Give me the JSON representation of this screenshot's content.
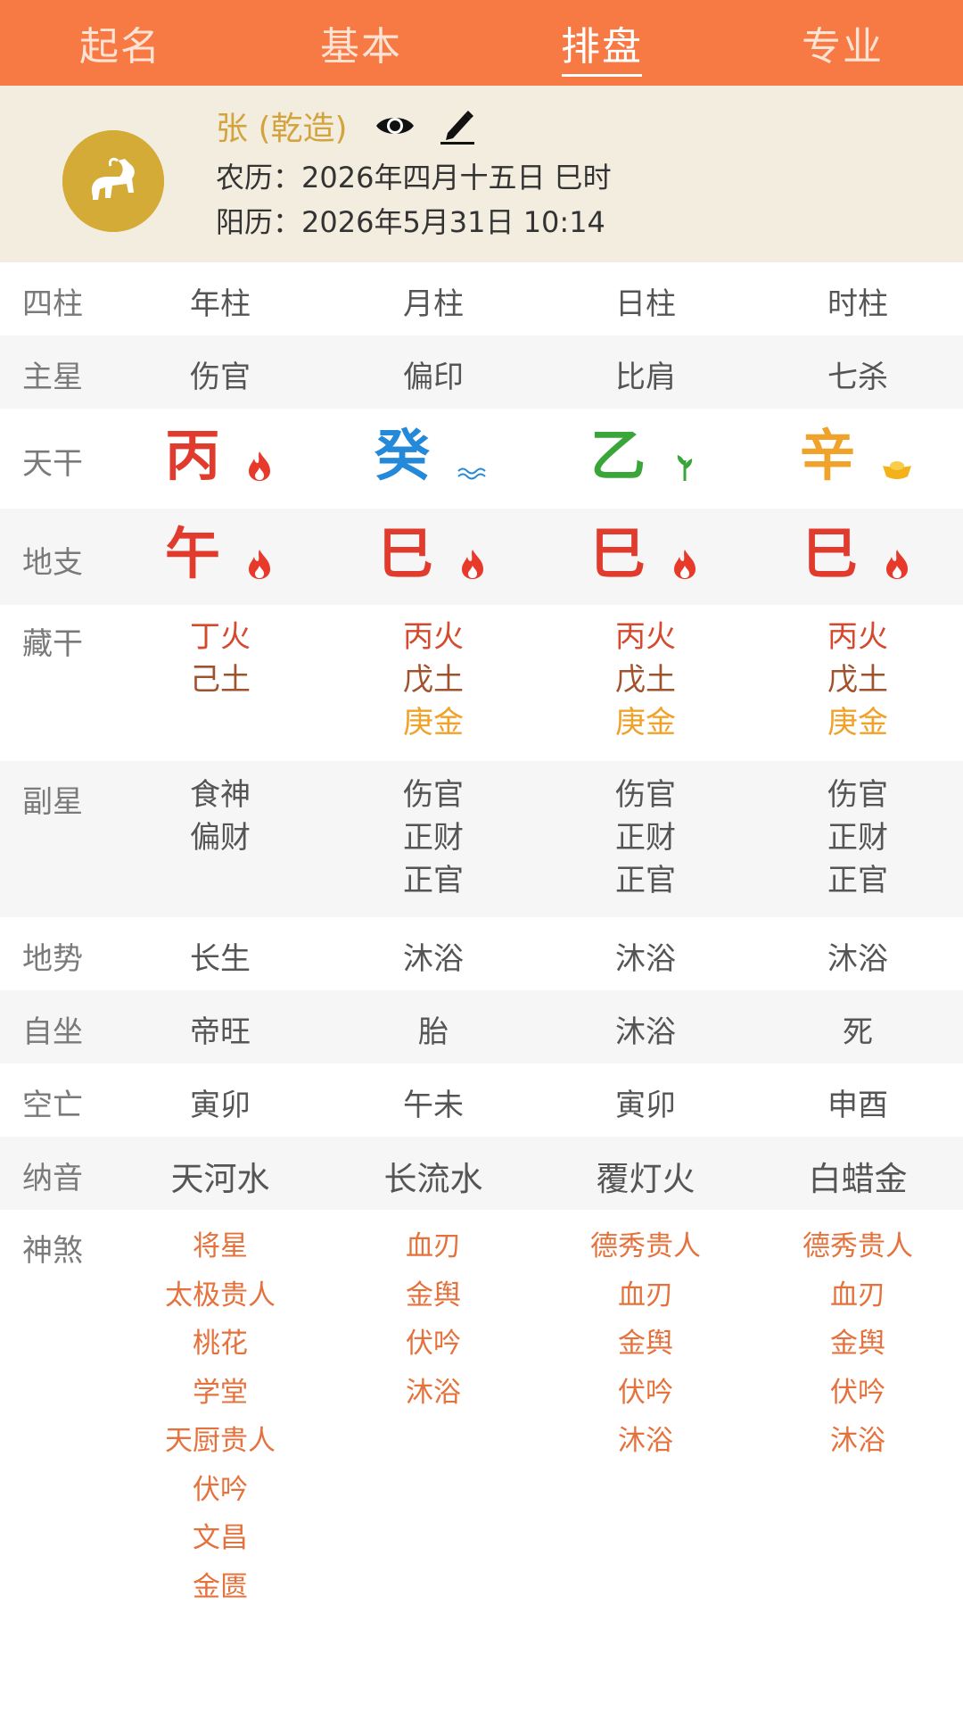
{
  "tabs": [
    {
      "label": "起名",
      "active": false
    },
    {
      "label": "基本",
      "active": false
    },
    {
      "label": "排盘",
      "active": true
    },
    {
      "label": "专业",
      "active": false
    }
  ],
  "profile": {
    "avatar_icon": "horse-zodiac-icon",
    "name": "张 (乾造)",
    "lunar": "农历：2026年四月十五日 巳时",
    "solar": "阳历：2026年5月31日 10:14"
  },
  "rows": {
    "sizhu": {
      "label": "四柱",
      "values": [
        "年柱",
        "月柱",
        "日柱",
        "时柱"
      ]
    },
    "zhuxing": {
      "label": "主星",
      "values": [
        "伤官",
        "偏印",
        "比肩",
        "七杀"
      ]
    },
    "tiangan": {
      "label": "天干",
      "values": [
        {
          "char": "丙",
          "color": "#e03b2d",
          "icon": "fire-icon"
        },
        {
          "char": "癸",
          "color": "#2489d8",
          "icon": "water-icon"
        },
        {
          "char": "乙",
          "color": "#3aa63a",
          "icon": "wood-sprout-icon"
        },
        {
          "char": "辛",
          "color": "#f0a22a",
          "icon": "gold-ingot-icon"
        }
      ]
    },
    "dizhi": {
      "label": "地支",
      "values": [
        {
          "char": "午",
          "color": "#e03b2d",
          "icon": "fire-icon"
        },
        {
          "char": "巳",
          "color": "#e03b2d",
          "icon": "fire-icon"
        },
        {
          "char": "巳",
          "color": "#e03b2d",
          "icon": "fire-icon"
        },
        {
          "char": "巳",
          "color": "#e03b2d",
          "icon": "fire-icon"
        }
      ]
    },
    "canggan": {
      "label": "藏干",
      "values": [
        [
          {
            "text": "丁火",
            "color": "#d44a2f"
          },
          {
            "text": "己土",
            "color": "#a0522d"
          }
        ],
        [
          {
            "text": "丙火",
            "color": "#d44a2f"
          },
          {
            "text": "戊土",
            "color": "#a0522d"
          },
          {
            "text": "庚金",
            "color": "#f0a22a"
          }
        ],
        [
          {
            "text": "丙火",
            "color": "#d44a2f"
          },
          {
            "text": "戊土",
            "color": "#a0522d"
          },
          {
            "text": "庚金",
            "color": "#f0a22a"
          }
        ],
        [
          {
            "text": "丙火",
            "color": "#d44a2f"
          },
          {
            "text": "戊土",
            "color": "#a0522d"
          },
          {
            "text": "庚金",
            "color": "#f0a22a"
          }
        ]
      ]
    },
    "fuxing": {
      "label": "副星",
      "values": [
        [
          "食神",
          "偏财"
        ],
        [
          "伤官",
          "正财",
          "正官"
        ],
        [
          "伤官",
          "正财",
          "正官"
        ],
        [
          "伤官",
          "正财",
          "正官"
        ]
      ]
    },
    "dishi": {
      "label": "地势",
      "values": [
        "长生",
        "沐浴",
        "沐浴",
        "沐浴"
      ]
    },
    "zizuo": {
      "label": "自坐",
      "values": [
        "帝旺",
        "胎",
        "沐浴",
        "死"
      ]
    },
    "kongwang": {
      "label": "空亡",
      "values": [
        "寅卯",
        "午未",
        "寅卯",
        "申酉"
      ]
    },
    "nayin": {
      "label": "纳音",
      "values": [
        "天河水",
        "长流水",
        "覆灯火",
        "白蜡金"
      ]
    },
    "shensha": {
      "label": "神煞",
      "values": [
        [
          "将星",
          "太极贵人",
          "桃花",
          "学堂",
          "天厨贵人",
          "伏吟",
          "文昌",
          "金匮"
        ],
        [
          "血刃",
          "金舆",
          "伏吟",
          "沐浴"
        ],
        [
          "德秀贵人",
          "血刃",
          "金舆",
          "伏吟",
          "沐浴"
        ],
        [
          "德秀贵人",
          "血刃",
          "金舆",
          "伏吟",
          "沐浴"
        ]
      ]
    }
  }
}
